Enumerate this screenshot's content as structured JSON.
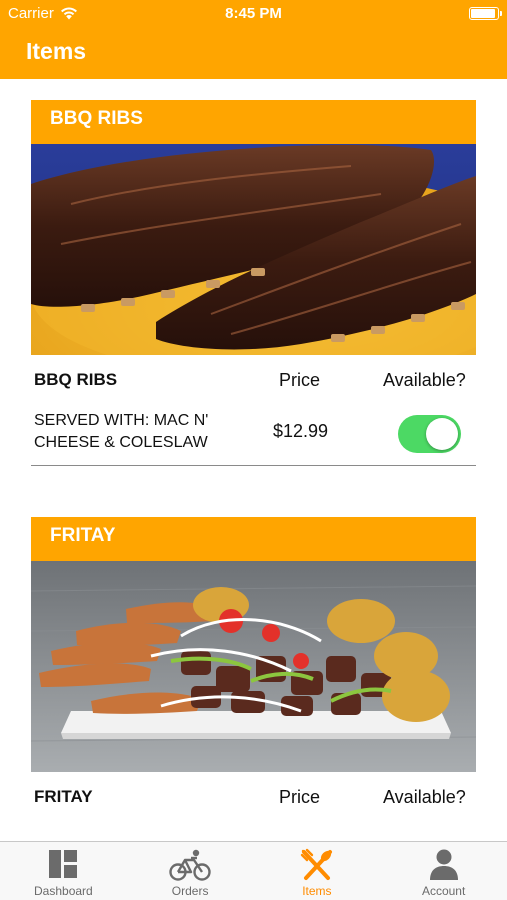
{
  "status_bar": {
    "carrier": "Carrier",
    "time": "8:45 PM"
  },
  "nav": {
    "title": "Items"
  },
  "columns": {
    "price": "Price",
    "available": "Available?"
  },
  "items": [
    {
      "banner": "BBQ RIBS",
      "name": "BBQ RIBS",
      "description": "SERVED WITH: MAC N' CHEESE & COLESLAW",
      "price": "$12.99",
      "available": true
    },
    {
      "banner": "FRITAY",
      "name": "FRITAY"
    }
  ],
  "tabs": [
    {
      "label": "Dashboard",
      "icon": "dashboard-icon"
    },
    {
      "label": "Orders",
      "icon": "bicycle-icon"
    },
    {
      "label": "Items",
      "icon": "utensils-icon",
      "active": true
    },
    {
      "label": "Account",
      "icon": "person-icon"
    }
  ],
  "colors": {
    "accent": "#FFA500",
    "active_tab": "#FF8C00",
    "toggle_on": "#4CD964"
  }
}
